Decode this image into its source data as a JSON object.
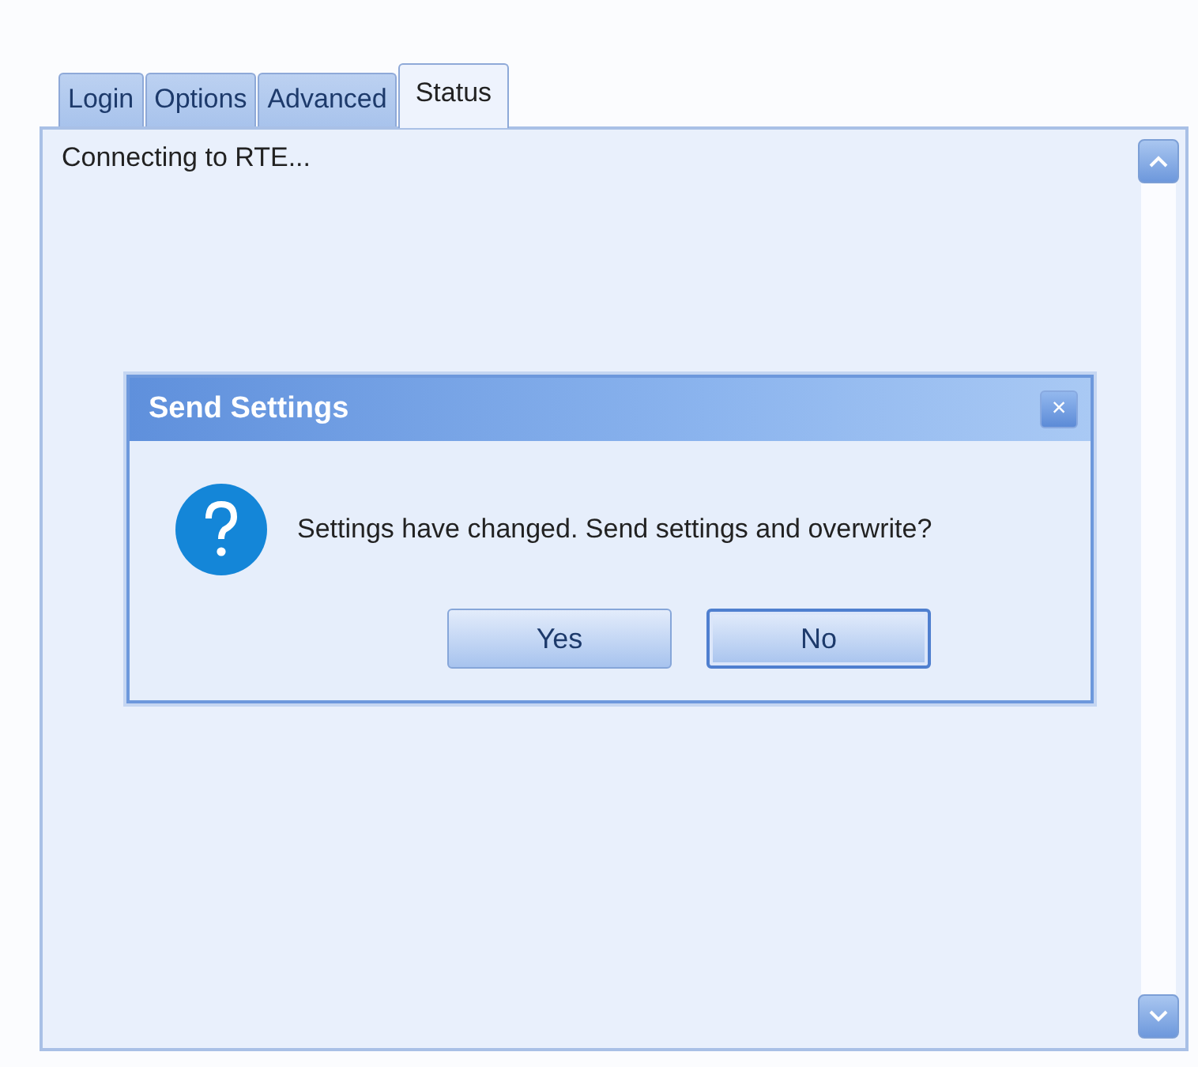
{
  "tabs": [
    {
      "label": "Login",
      "selected": false
    },
    {
      "label": "Options",
      "selected": false
    },
    {
      "label": "Advanced",
      "selected": false
    },
    {
      "label": "Status",
      "selected": true
    }
  ],
  "status_text": "Connecting to RTE...",
  "dialog": {
    "title": "Send Settings",
    "close": "×",
    "message": "Settings have changed. Send settings and overwrite?",
    "buttons": [
      {
        "label": "Yes",
        "focused": false
      },
      {
        "label": "No",
        "focused": true
      }
    ]
  }
}
